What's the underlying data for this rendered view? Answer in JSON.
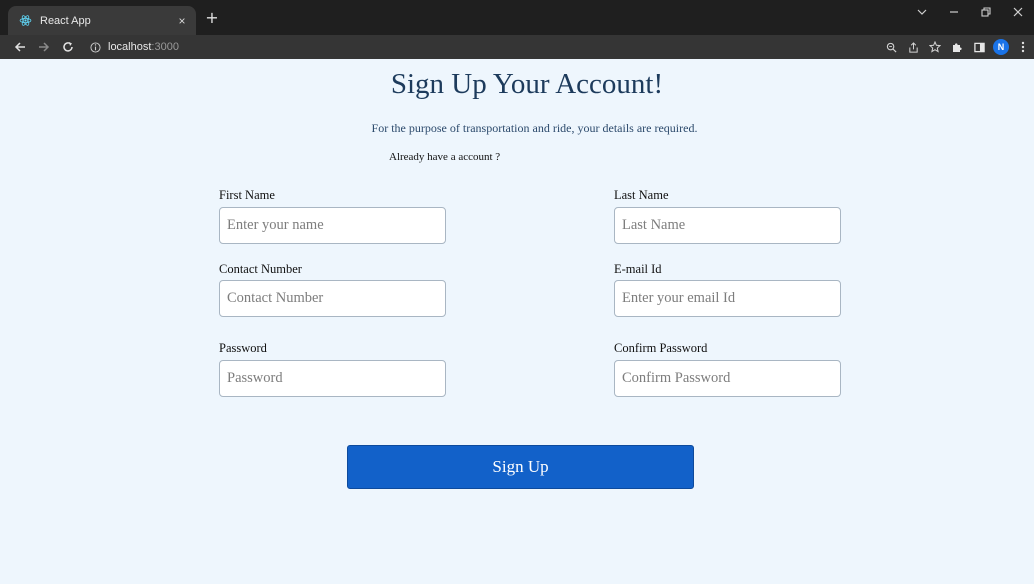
{
  "browser": {
    "tab_title": "React App",
    "tab_close": "×",
    "new_tab": "+",
    "url_host": "localhost",
    "url_port": ":3000",
    "profile_initial": "N",
    "icons": [
      "react-logo",
      "back-arrow",
      "forward-arrow",
      "reload",
      "info",
      "zoom",
      "share",
      "bookmark-star",
      "extensions-puzzle",
      "side-panel",
      "profile-avatar",
      "more-menu"
    ]
  },
  "page": {
    "title": "Sign Up Your Account!",
    "subtitle": "For the purpose of transportation and ride, your details are required.",
    "already_text": "Already have a account ?"
  },
  "form": {
    "first_name": {
      "label": "First Name",
      "placeholder": "Enter your name"
    },
    "last_name": {
      "label": "Last Name",
      "placeholder": "Last Name"
    },
    "contact": {
      "label": "Contact Number",
      "placeholder": "Contact Number"
    },
    "email": {
      "label": "E-mail Id",
      "placeholder": "Enter your email Id"
    },
    "password": {
      "label": "Password",
      "placeholder": "Password"
    },
    "confirm_password": {
      "label": "Confirm Password",
      "placeholder": "Confirm Password"
    },
    "submit_label": "Sign Up"
  },
  "colors": {
    "page_background": "#eef6fd",
    "title_color": "#1d3b5c",
    "button_color": "#1261c9"
  }
}
